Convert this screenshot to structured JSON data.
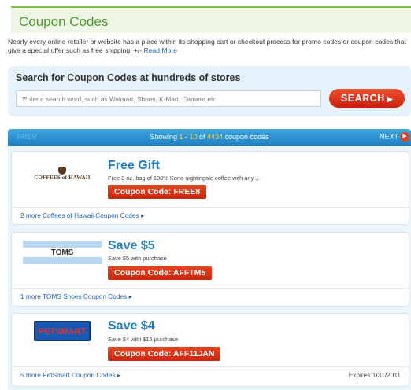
{
  "header": {
    "title": "Coupon Codes"
  },
  "intro": {
    "text": "Nearly every online retailer or website has a place within its shopping cart or checkout process for promo codes or coupon codes that give a special offer such as free shipping, +/-",
    "more_link": "Read More"
  },
  "search": {
    "heading": "Search for Coupon Codes at hundreds of stores",
    "placeholder": "Enter a search word, such as Walmart, Shoes, K-Mart, Camera etc.",
    "button_label": "SEARCH",
    "button_icon": "triangle-right-icon"
  },
  "results": {
    "prev_label": "PREV",
    "showing_prefix": "Showing ",
    "range_start": "1",
    "range_sep": " - ",
    "range_end": "10",
    "of_label": " of ",
    "total": "4434",
    "suffix": " coupon codes",
    "next_label": "NEXT",
    "colors": {
      "bar": "#1e7fc2",
      "highlight": "#ffd23a",
      "code_button": "#d8361a"
    }
  },
  "coupons": [
    {
      "store_logo_text": "COFFEES of HAWAII",
      "title": "Free Gift",
      "description": "Free 8 oz. bag of 100% Kona nightingale coffee with any ...",
      "code_label": "Coupon Code: FREE8",
      "more_link": "2 more Coffees of Hawaii Coupon Codes ▸",
      "expires": ""
    },
    {
      "store_logo_text": "TOMS",
      "title": "Save $5",
      "description": "Save $5 with purchase",
      "code_label": "Coupon Code: AFFTM5",
      "more_link": "1 more TOMS Shoes Coupon Codes ▸",
      "expires": ""
    },
    {
      "store_logo_text": "PETSMART",
      "title": "Save $4",
      "description": "Save $4 with $15 purchase",
      "code_label": "Coupon Code: AFF11JAN",
      "more_link": "5 more PetSmart Coupon Codes ▸",
      "expires": "Expires 1/31/2011"
    }
  ]
}
